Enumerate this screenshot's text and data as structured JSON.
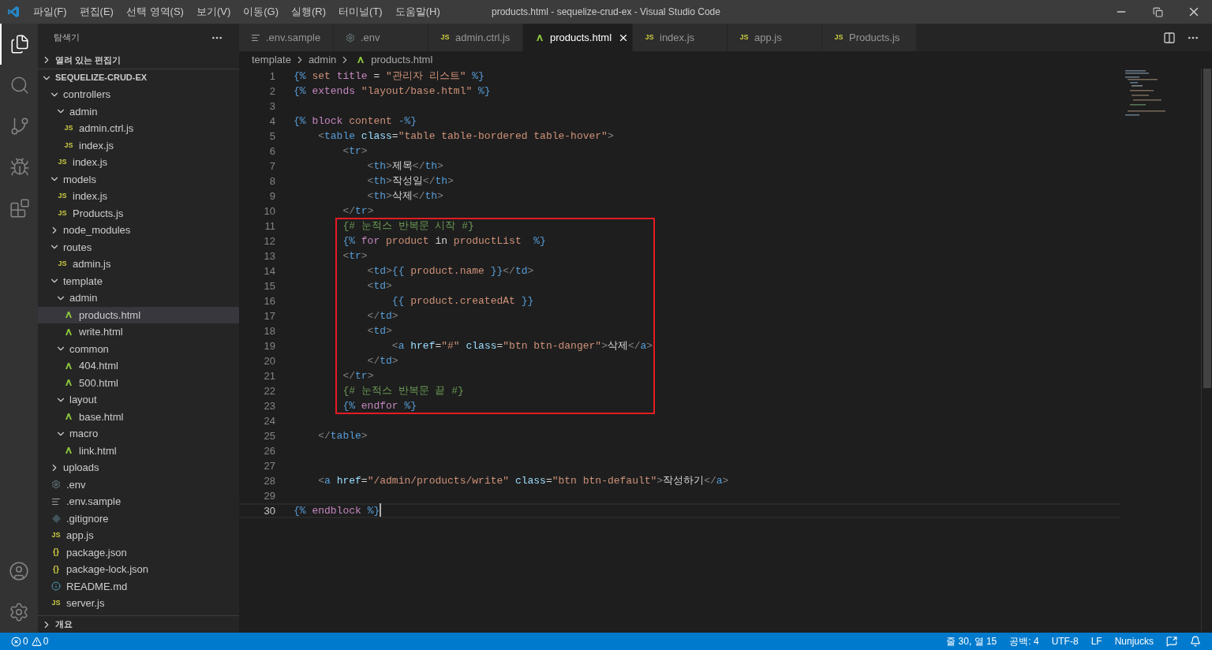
{
  "window": {
    "title": "products.html - sequelize-crud-ex - Visual Studio Code"
  },
  "menu": [
    "파일(F)",
    "편집(E)",
    "선택 영역(S)",
    "보기(V)",
    "이동(G)",
    "실행(R)",
    "터미널(T)",
    "도움말(H)"
  ],
  "activity_bar": [
    {
      "kind": "files",
      "selected": true
    },
    {
      "kind": "search",
      "selected": false
    },
    {
      "kind": "source-control",
      "selected": false
    },
    {
      "kind": "run",
      "selected": false
    },
    {
      "kind": "extensions",
      "selected": false
    }
  ],
  "sidebar": {
    "title": "탐색기",
    "open_editors": {
      "label": "열려 있는 편집기",
      "expanded": false
    },
    "project": {
      "label": "SEQUELIZE-CRUD-EX",
      "expanded": true
    },
    "tree": [
      {
        "name": "controllers",
        "kind": "folder",
        "expanded": true,
        "children": [
          {
            "name": "admin",
            "kind": "folder",
            "expanded": true,
            "children": [
              {
                "name": "admin.ctrl.js",
                "kind": "js",
                "icon_text": "JS",
                "selected": false
              },
              {
                "name": "index.js",
                "kind": "js",
                "icon_text": "JS",
                "selected": false
              }
            ]
          },
          {
            "name": "index.js",
            "kind": "js",
            "icon_text": "JS",
            "selected": false
          }
        ]
      },
      {
        "name": "models",
        "kind": "folder",
        "expanded": true,
        "children": [
          {
            "name": "index.js",
            "kind": "js",
            "icon_text": "JS",
            "selected": false
          },
          {
            "name": "Products.js",
            "kind": "js",
            "icon_text": "JS",
            "selected": false
          }
        ]
      },
      {
        "name": "node_modules",
        "kind": "folder",
        "expanded": false
      },
      {
        "name": "routes",
        "kind": "folder",
        "expanded": true,
        "children": [
          {
            "name": "admin.js",
            "kind": "js",
            "icon_text": "JS",
            "selected": false
          }
        ]
      },
      {
        "name": "template",
        "kind": "folder",
        "expanded": true,
        "children": [
          {
            "name": "admin",
            "kind": "folder",
            "expanded": true,
            "children": [
              {
                "name": "products.html",
                "kind": "html",
                "selected": true
              },
              {
                "name": "write.html",
                "kind": "html",
                "selected": false
              }
            ]
          },
          {
            "name": "common",
            "kind": "folder",
            "expanded": true,
            "children": [
              {
                "name": "404.html",
                "kind": "html",
                "selected": false
              },
              {
                "name": "500.html",
                "kind": "html",
                "selected": false
              }
            ]
          },
          {
            "name": "layout",
            "kind": "folder",
            "expanded": true,
            "children": [
              {
                "name": "base.html",
                "kind": "html",
                "selected": false
              }
            ]
          },
          {
            "name": "macro",
            "kind": "folder",
            "expanded": true,
            "children": [
              {
                "name": "link.html",
                "kind": "html",
                "selected": false
              }
            ]
          }
        ]
      },
      {
        "name": "uploads",
        "kind": "folder",
        "expanded": false
      },
      {
        "name": ".env",
        "kind": "gear",
        "selected": false
      },
      {
        "name": ".env.sample",
        "kind": "lines",
        "selected": false
      },
      {
        "name": ".gitignore",
        "kind": "git",
        "selected": false
      },
      {
        "name": "app.js",
        "kind": "js",
        "icon_text": "JS",
        "selected": false
      },
      {
        "name": "package.json",
        "kind": "json",
        "icon_text": "{}",
        "selected": false
      },
      {
        "name": "package-lock.json",
        "kind": "json",
        "icon_text": "{}",
        "selected": false
      },
      {
        "name": "README.md",
        "kind": "info",
        "selected": false
      },
      {
        "name": "server.js",
        "kind": "js",
        "icon_text": "JS",
        "selected": false
      }
    ],
    "outline": {
      "label": "개요",
      "expanded": false
    }
  },
  "tabs": [
    {
      "label": ".env.sample",
      "kind": "lines",
      "selected": false
    },
    {
      "label": ".env",
      "kind": "gear",
      "selected": false
    },
    {
      "label": "admin.ctrl.js",
      "kind": "js",
      "icon_text": "JS",
      "selected": false
    },
    {
      "label": "products.html",
      "kind": "html",
      "selected": true
    },
    {
      "label": "index.js",
      "kind": "js",
      "icon_text": "JS",
      "selected": false
    },
    {
      "label": "app.js",
      "kind": "js",
      "icon_text": "JS",
      "selected": false
    },
    {
      "label": "Products.js",
      "kind": "js",
      "icon_text": "JS",
      "selected": false
    }
  ],
  "breadcrumbs": [
    {
      "label": "template",
      "kind": "folder"
    },
    {
      "label": "admin",
      "kind": "folder"
    },
    {
      "label": "products.html",
      "kind": "html"
    }
  ],
  "code": [
    {
      "kind": "line",
      "number": "1",
      "tokens": [
        {
          "kind": "delim",
          "text": "{%"
        },
        {
          "kind": "identifier",
          "text": " set"
        },
        {
          "kind": "keyword",
          "text": " title"
        },
        {
          "kind": "text",
          "text": " ="
        },
        {
          "kind": "string",
          "text": " \"관리자 리스트\""
        },
        {
          "kind": "delim",
          "text": " %}"
        }
      ]
    },
    {
      "kind": "line",
      "number": "2",
      "tokens": [
        {
          "kind": "delim",
          "text": "{%"
        },
        {
          "kind": "keyword",
          "text": " extends"
        },
        {
          "kind": "string",
          "text": " \"layout/base.html\""
        },
        {
          "kind": "delim",
          "text": " %}"
        }
      ]
    },
    {
      "kind": "line",
      "number": "3"
    },
    {
      "kind": "line",
      "number": "4",
      "tokens": [
        {
          "kind": "delim",
          "text": "{%"
        },
        {
          "kind": "keyword",
          "text": " block"
        },
        {
          "kind": "identifier",
          "text": " content"
        },
        {
          "kind": "delim",
          "text": " -%}"
        }
      ]
    },
    {
      "kind": "line",
      "number": "5",
      "tokens": [
        {
          "kind": "bracket",
          "text": "    <"
        },
        {
          "kind": "tag",
          "text": "table"
        },
        {
          "kind": "attr",
          "text": " class"
        },
        {
          "kind": "text",
          "text": "="
        },
        {
          "kind": "string",
          "text": "\"table table-bordered table-hover\""
        },
        {
          "kind": "bracket",
          "text": ">"
        }
      ]
    },
    {
      "kind": "line",
      "number": "6",
      "tokens": [
        {
          "kind": "bracket",
          "text": "        <"
        },
        {
          "kind": "tag",
          "text": "tr"
        },
        {
          "kind": "bracket",
          "text": ">"
        }
      ]
    },
    {
      "kind": "line",
      "number": "7",
      "tokens": [
        {
          "kind": "bracket",
          "text": "            <"
        },
        {
          "kind": "tag",
          "text": "th"
        },
        {
          "kind": "bracket",
          "text": ">"
        },
        {
          "kind": "text",
          "text": "제목"
        },
        {
          "kind": "bracket",
          "text": "</"
        },
        {
          "kind": "tag",
          "text": "th"
        },
        {
          "kind": "bracket",
          "text": ">"
        }
      ]
    },
    {
      "kind": "line",
      "number": "8",
      "tokens": [
        {
          "kind": "bracket",
          "text": "            <"
        },
        {
          "kind": "tag",
          "text": "th"
        },
        {
          "kind": "bracket",
          "text": ">"
        },
        {
          "kind": "text",
          "text": "작성일"
        },
        {
          "kind": "bracket",
          "text": "</"
        },
        {
          "kind": "tag",
          "text": "th"
        },
        {
          "kind": "bracket",
          "text": ">"
        }
      ]
    },
    {
      "kind": "line",
      "number": "9",
      "tokens": [
        {
          "kind": "bracket",
          "text": "            <"
        },
        {
          "kind": "tag",
          "text": "th"
        },
        {
          "kind": "bracket",
          "text": ">"
        },
        {
          "kind": "text",
          "text": "삭제"
        },
        {
          "kind": "bracket",
          "text": "</"
        },
        {
          "kind": "tag",
          "text": "th"
        },
        {
          "kind": "bracket",
          "text": ">"
        }
      ]
    },
    {
      "kind": "line",
      "number": "10",
      "tokens": [
        {
          "kind": "bracket",
          "text": "        </"
        },
        {
          "kind": "tag",
          "text": "tr"
        },
        {
          "kind": "bracket",
          "text": ">"
        }
      ]
    },
    {
      "kind": "highlight",
      "lines": [
        {
          "number": "11",
          "tokens": [
            {
              "kind": "comment",
              "text": "        {# 눈적스 반복문 시작 #}"
            }
          ]
        },
        {
          "number": "12",
          "tokens": [
            {
              "kind": "delim",
              "text": "        {%"
            },
            {
              "kind": "keyword",
              "text": " for"
            },
            {
              "kind": "identifier",
              "text": " product"
            },
            {
              "kind": "text",
              "text": " in"
            },
            {
              "kind": "identifier",
              "text": " productList"
            },
            {
              "kind": "delim",
              "text": "  %}"
            }
          ]
        },
        {
          "number": "13",
          "tokens": [
            {
              "kind": "bracket",
              "text": "        <"
            },
            {
              "kind": "tag",
              "text": "tr"
            },
            {
              "kind": "bracket",
              "text": ">"
            }
          ]
        },
        {
          "number": "14",
          "tokens": [
            {
              "kind": "bracket",
              "text": "            <"
            },
            {
              "kind": "tag",
              "text": "td"
            },
            {
              "kind": "bracket",
              "text": ">"
            },
            {
              "kind": "delim",
              "text": "{{"
            },
            {
              "kind": "identifier",
              "text": " product.name"
            },
            {
              "kind": "delim",
              "text": " }}"
            },
            {
              "kind": "bracket",
              "text": "</"
            },
            {
              "kind": "tag",
              "text": "td"
            },
            {
              "kind": "bracket",
              "text": ">"
            }
          ]
        },
        {
          "number": "15",
          "tokens": [
            {
              "kind": "bracket",
              "text": "            <"
            },
            {
              "kind": "tag",
              "text": "td"
            },
            {
              "kind": "bracket",
              "text": ">"
            }
          ]
        },
        {
          "number": "16",
          "tokens": [
            {
              "kind": "delim",
              "text": "                {{"
            },
            {
              "kind": "identifier",
              "text": " product.createdAt"
            },
            {
              "kind": "delim",
              "text": " }}"
            }
          ]
        },
        {
          "number": "17",
          "tokens": [
            {
              "kind": "bracket",
              "text": "            </"
            },
            {
              "kind": "tag",
              "text": "td"
            },
            {
              "kind": "bracket",
              "text": ">"
            }
          ]
        },
        {
          "number": "18",
          "tokens": [
            {
              "kind": "bracket",
              "text": "            <"
            },
            {
              "kind": "tag",
              "text": "td"
            },
            {
              "kind": "bracket",
              "text": ">"
            }
          ]
        },
        {
          "number": "19",
          "tokens": [
            {
              "kind": "bracket",
              "text": "                <"
            },
            {
              "kind": "tag",
              "text": "a"
            },
            {
              "kind": "attr",
              "text": " href"
            },
            {
              "kind": "text",
              "text": "="
            },
            {
              "kind": "string",
              "text": "\"#\""
            },
            {
              "kind": "attr",
              "text": " class"
            },
            {
              "kind": "text",
              "text": "="
            },
            {
              "kind": "string",
              "text": "\"btn btn-danger\""
            },
            {
              "kind": "bracket",
              "text": ">"
            },
            {
              "kind": "text",
              "text": "삭제"
            },
            {
              "kind": "bracket",
              "text": "</"
            },
            {
              "kind": "tag",
              "text": "a"
            },
            {
              "kind": "bracket",
              "text": ">"
            }
          ]
        },
        {
          "number": "20",
          "tokens": [
            {
              "kind": "bracket",
              "text": "            </"
            },
            {
              "kind": "tag",
              "text": "td"
            },
            {
              "kind": "bracket",
              "text": ">"
            }
          ]
        },
        {
          "number": "21",
          "tokens": [
            {
              "kind": "bracket",
              "text": "        </"
            },
            {
              "kind": "tag",
              "text": "tr"
            },
            {
              "kind": "bracket",
              "text": ">"
            }
          ]
        },
        {
          "number": "22",
          "tokens": [
            {
              "kind": "comment",
              "text": "        {# 눈적스 반복문 끝 #}"
            }
          ]
        },
        {
          "number": "23",
          "tokens": [
            {
              "kind": "delim",
              "text": "        {%"
            },
            {
              "kind": "keyword",
              "text": " endfor"
            },
            {
              "kind": "delim",
              "text": " %}"
            }
          ]
        }
      ]
    },
    {
      "kind": "line",
      "number": "24"
    },
    {
      "kind": "line",
      "number": "25",
      "tokens": [
        {
          "kind": "bracket",
          "text": "    </"
        },
        {
          "kind": "tag",
          "text": "table"
        },
        {
          "kind": "bracket",
          "text": ">"
        }
      ]
    },
    {
      "kind": "line",
      "number": "26"
    },
    {
      "kind": "line",
      "number": "27"
    },
    {
      "kind": "line",
      "number": "28",
      "tokens": [
        {
          "kind": "bracket",
          "text": "    <"
        },
        {
          "kind": "tag",
          "text": "a"
        },
        {
          "kind": "attr",
          "text": " href"
        },
        {
          "kind": "text",
          "text": "="
        },
        {
          "kind": "string",
          "text": "\"/admin/products/write\""
        },
        {
          "kind": "attr",
          "text": " class"
        },
        {
          "kind": "text",
          "text": "="
        },
        {
          "kind": "string",
          "text": "\"btn btn-default\""
        },
        {
          "kind": "bracket",
          "text": ">"
        },
        {
          "kind": "text",
          "text": "작성하기"
        },
        {
          "kind": "bracket",
          "text": "</"
        },
        {
          "kind": "tag",
          "text": "a"
        },
        {
          "kind": "bracket",
          "text": ">"
        }
      ]
    },
    {
      "kind": "line",
      "number": "29"
    },
    {
      "kind": "current_line",
      "number": "30",
      "tokens": [
        {
          "kind": "delim",
          "text": "{%"
        },
        {
          "kind": "keyword",
          "text": " endblock"
        },
        {
          "kind": "delim",
          "text": " %}"
        }
      ]
    }
  ],
  "status_bar": {
    "errors": "0",
    "warnings": "0",
    "items": [
      "줄 30, 열 15",
      "공백: 4",
      "UTF-8",
      "LF",
      "Nunjucks"
    ]
  }
}
